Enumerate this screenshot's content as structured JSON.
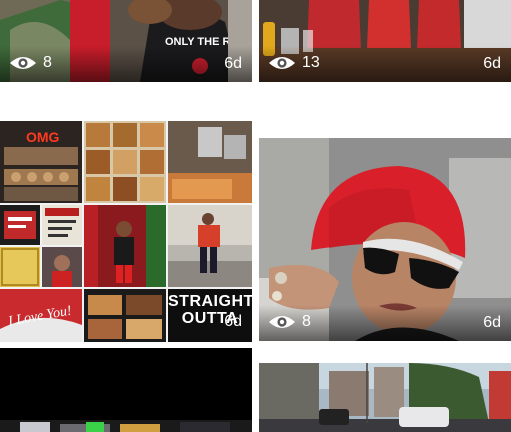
{
  "tiles": [
    {
      "views": "8",
      "age": "6d"
    },
    {
      "views": "13",
      "age": "6d"
    },
    {
      "collage_text": "STRAIGHT OUTTA",
      "collage_age": "6d",
      "collage_sign": "OMG",
      "collage_script": "I Love You!"
    },
    {
      "views": "8",
      "age": "6d"
    },
    {},
    {}
  ],
  "icons": {
    "views": "eye-icon"
  },
  "colors": {
    "overlay_text": "#ffffff",
    "hat_red": "#d9202a",
    "background": "#ffffff"
  }
}
